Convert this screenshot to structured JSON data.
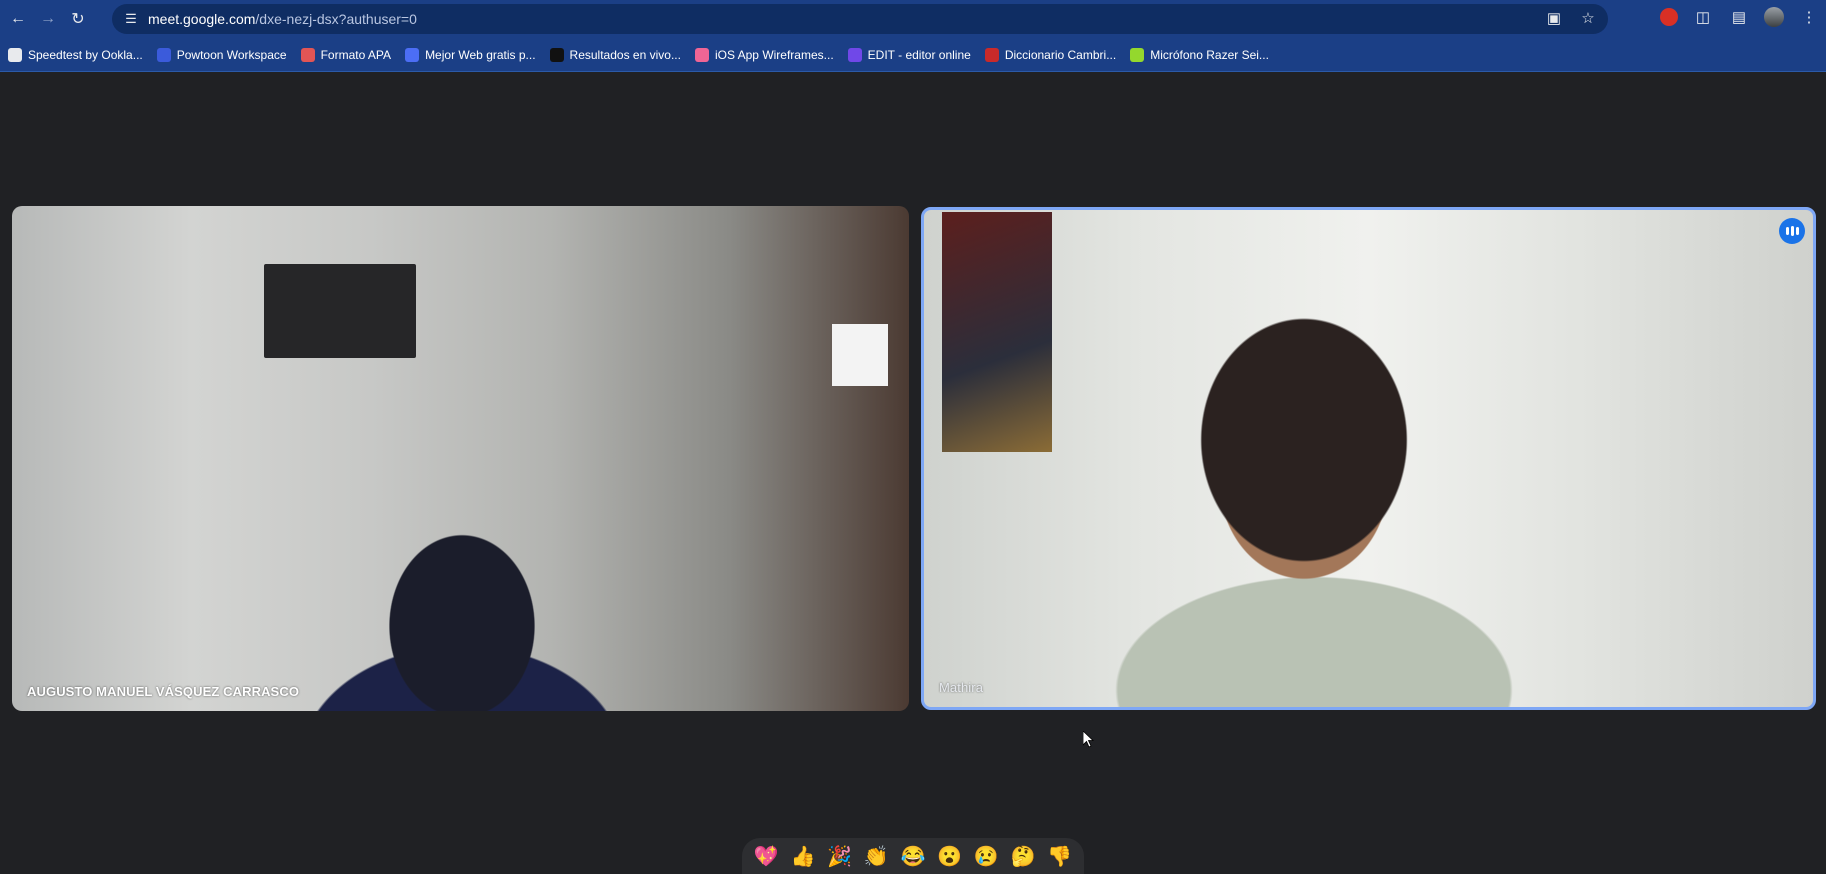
{
  "browser": {
    "url_host": "meet.google.com",
    "url_path": "/dxe-nezj-dsx?authuser=0",
    "bookmarks": [
      {
        "label": "Speedtest by Ookla...",
        "color": "#e8eaed"
      },
      {
        "label": "Powtoon Workspace",
        "color": "#3b5bdb"
      },
      {
        "label": "Formato APA",
        "color": "#e25555"
      },
      {
        "label": "Mejor Web gratis p...",
        "color": "#4c6ef5"
      },
      {
        "label": "Resultados en vivo...",
        "color": "#111111"
      },
      {
        "label": "iOS App Wireframes...",
        "color": "#f06595"
      },
      {
        "label": "EDIT - editor online",
        "color": "#7048e8"
      },
      {
        "label": "Diccionario Cambri...",
        "color": "#c92a2a"
      },
      {
        "label": "Micrófono Razer Sei...",
        "color": "#94d82d"
      }
    ]
  },
  "meet": {
    "participants": [
      {
        "name": "AUGUSTO MANUEL VÁSQUEZ CARRASCO"
      },
      {
        "name": "Mathira"
      }
    ],
    "reactions": [
      "💖",
      "👍",
      "🎉",
      "👏",
      "😂",
      "😮",
      "😢",
      "🤔",
      "👎"
    ]
  },
  "colors": {
    "chrome": "#1b3f86",
    "stage": "#202124",
    "active_border": "#7ea7f5",
    "badge": "#1a73e8"
  }
}
